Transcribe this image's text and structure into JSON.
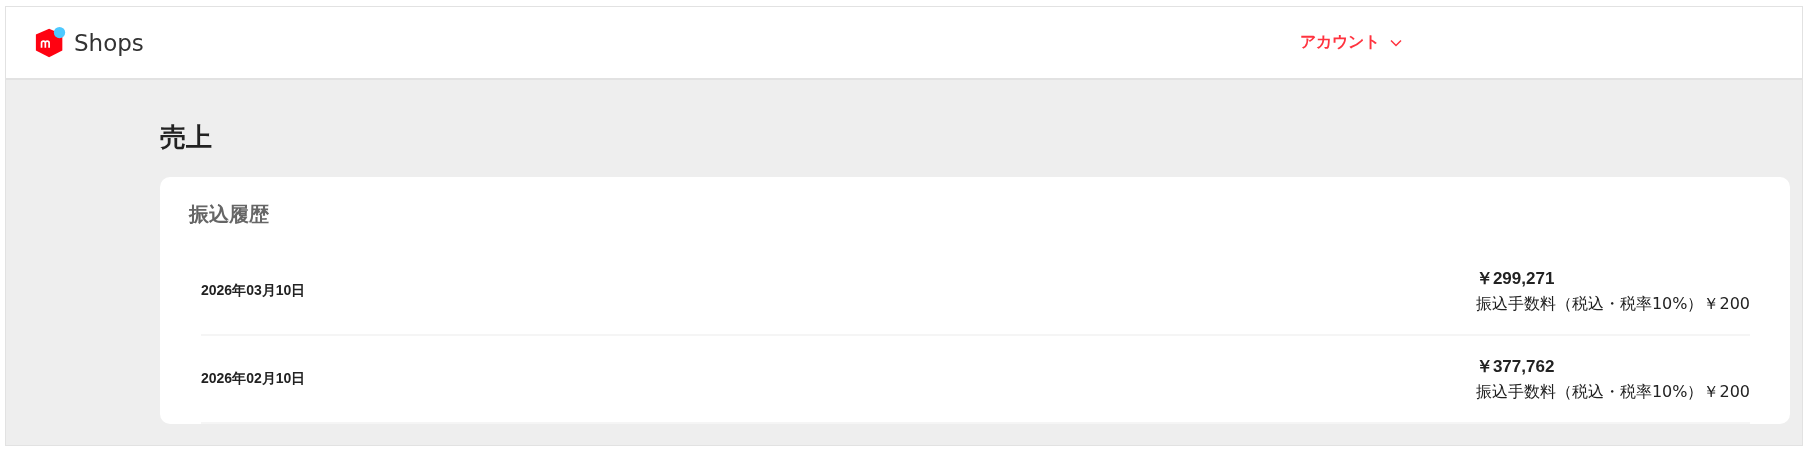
{
  "header": {
    "logo_text": "Shops",
    "account_menu": {
      "label": "アカウント"
    }
  },
  "page_title": "売上",
  "card": {
    "title": "振込履歴",
    "rows": [
      {
        "date": "2026年03月10日",
        "amount": "￥299,271",
        "fee": "振込手数料（税込・税率10%）￥200"
      },
      {
        "date": "2026年02月10日",
        "amount": "￥377,762",
        "fee": "振込手数料（税込・税率10%）￥200"
      }
    ]
  }
}
